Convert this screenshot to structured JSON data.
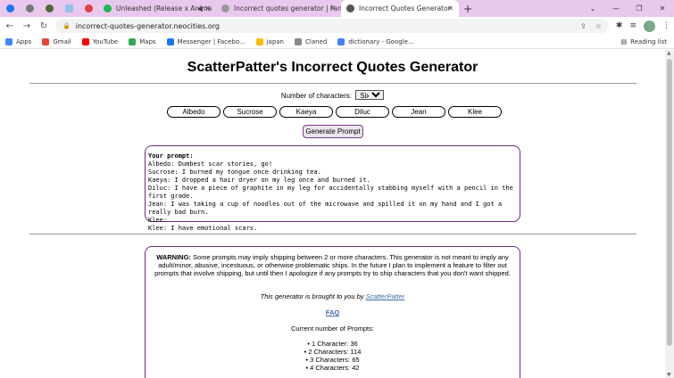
{
  "browser": {
    "tabs": [
      {
        "label": "Unleashed (Release x Anima"
      },
      {
        "label": "Incorrect quotes generator | Fan"
      },
      {
        "label": "Incorrect Quotes Generator"
      }
    ],
    "url": "incorrect-quotes-generator.neocities.org",
    "bookmarks": [
      "Apps",
      "Gmail",
      "YouTube",
      "Maps",
      "Messenger | Facebo...",
      "japan",
      "Claned",
      "dictionary - Google..."
    ],
    "reading_list": "Reading list"
  },
  "page": {
    "title": "ScatterPatter's Incorrect Quotes Generator",
    "num_label": "Number of characters:",
    "num_value": "Six",
    "characters": [
      "Albedo",
      "Sucrose",
      "Kaeya",
      "Diluc",
      "Jean",
      "Klee"
    ],
    "generate_label": "Generate Prompt",
    "prompt_heading": "Your prompt:",
    "prompt_lines": [
      "Albedo: Dumbest scar stories, go!",
      "Sucrose: I burned my tongue once drinking tea.",
      "Kaeya: I dropped a hair dryer on my leg once and burned it.",
      "Diluc: I have a piece of graphite in my leg for accidentally stabbing myself with a pencil in the first grade.",
      "Jean: I was taking a cup of noodles out of the microwave and spilled it on my hand and I got a really bad burn.",
      "Klee:",
      "Klee: I have emotional scars."
    ],
    "warning_label": "WARNING:",
    "warning_text": " Some prompts may imply shipping between 2 or more characters. This generator is not meant to imply any adult/minor, abusive, incestuous, or otherwise problematic ships. In the future I plan to implement a feature to filter out prompts that involve shipping, but until then I apologize if any prompts try to ship characters that you don't want shipped.",
    "brought_text": "This generator is brought to you by ",
    "brought_link": "ScatterPatter",
    "faq": "FAQ",
    "count_label": "Current number of Prompts:",
    "counts": [
      "1 Character: 36",
      "2 Characters: 114",
      "3 Characters: 65",
      "4 Characters: 42"
    ]
  }
}
